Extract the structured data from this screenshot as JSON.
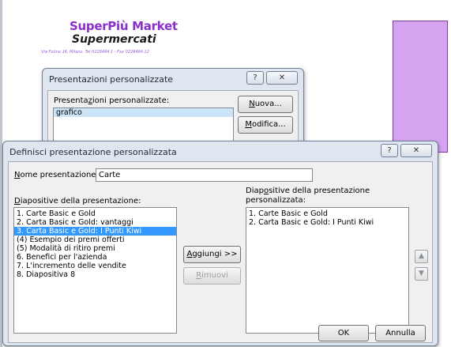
{
  "slide": {
    "logo_line1": "SuperPiù Market",
    "logo_line2": "Supermercati",
    "address": "Via Fotino 16, Milano. Tel 0228484.1 - Fax 0228484.12"
  },
  "bg_dialog": {
    "title": "Presentazioni personalizzate",
    "help_label": "?",
    "close_label": "✕",
    "list_label_pre": "Presentazioni personalizzate:",
    "items": [
      "grafico"
    ],
    "new_label": "Nuova...",
    "edit_label": "Modifica..."
  },
  "dialog": {
    "title": "Definisci presentazione personalizzata",
    "help_label": "?",
    "close_label": "✕",
    "name_label": "Nome presentazione:",
    "name_value": "Carte",
    "left_label": "Diapositive della presentazione:",
    "right_label_line1": "Diapositive della presentazione",
    "right_label_line2": "personalizzata:",
    "left_items": [
      "1. Carte Basic e Gold",
      "2. Carta Basic e Gold: vantaggi",
      "3. Carta Basic e Gold: I Punti Kiwi",
      "(4) Esempio dei premi offerti",
      "(5) Modalità di ritiro premi",
      "6. Benefici per l'azienda",
      "7. L'incremento delle vendite",
      "8. Diapositiva 8"
    ],
    "right_items": [
      "1. Carte Basic e Gold",
      "2. Carta Basic e Gold: I Punti Kiwi"
    ],
    "add_label": "Aggiungi >>",
    "remove_label": "Rimuovi",
    "up_icon": "arrow-up-icon",
    "down_icon": "arrow-down-icon",
    "ok_label": "OK",
    "cancel_label": "Annulla"
  }
}
